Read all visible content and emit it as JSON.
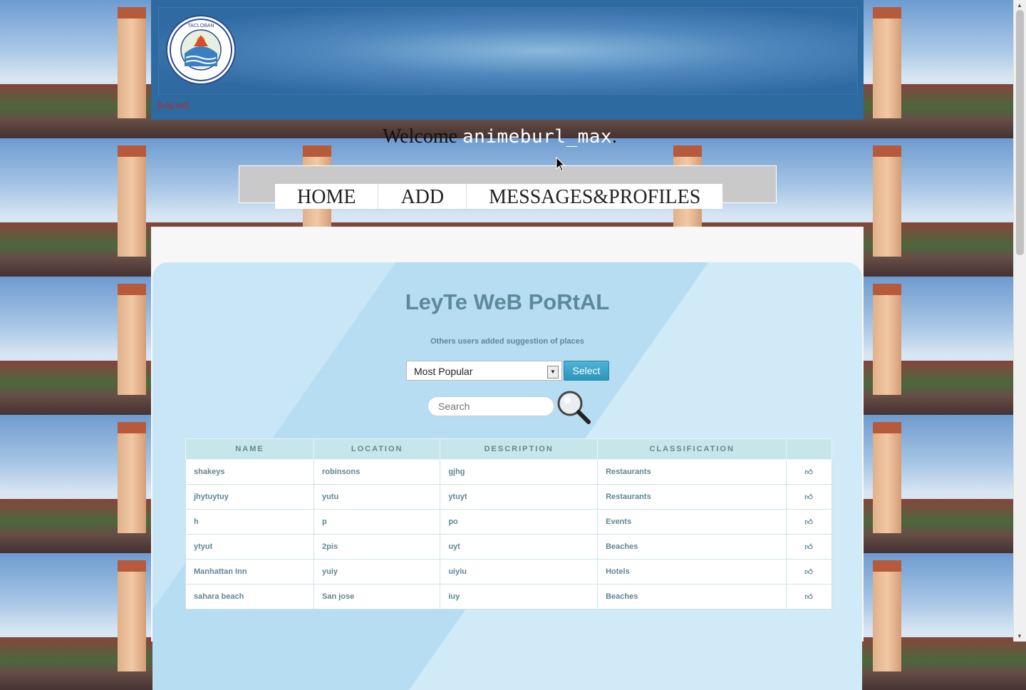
{
  "header": {
    "logo_text": "CITY OF TACLOBAN · PHILIPPINES · 19 53",
    "logout_label": "[Log out]"
  },
  "welcome": {
    "prefix": "Welcome",
    "username": "animeburl_max",
    "suffix": "."
  },
  "nav": {
    "items": [
      {
        "label": "HOME"
      },
      {
        "label": "ADD"
      },
      {
        "label": "MESSAGES&PROFILES"
      }
    ]
  },
  "main": {
    "title": "LeyTe WeB PoRtAL",
    "subtitle": "Others users added suggestion of places",
    "filter": {
      "selected": "Most Popular",
      "button_label": "Select"
    },
    "search": {
      "placeholder": "Search"
    }
  },
  "table": {
    "headers": [
      "NAME",
      "LOCATION",
      "DESCRIPTION",
      "CLASSIFICATION",
      ""
    ],
    "rows": [
      {
        "name": "shakeys",
        "location": "robinsons",
        "description": "gjhg",
        "classification": "Restaurants"
      },
      {
        "name": "jhytuytuy",
        "location": "yutu",
        "description": "ytuyt",
        "classification": "Restaurants"
      },
      {
        "name": "h",
        "location": "p",
        "description": "po",
        "classification": "Events"
      },
      {
        "name": "ytyut",
        "location": "2pis",
        "description": "uyt",
        "classification": "Beaches"
      },
      {
        "name": "Manhattan Inn",
        "location": "yuiy",
        "description": "uiyiu",
        "classification": "Hotels"
      },
      {
        "name": "sahara beach",
        "location": "San jose",
        "description": "iuy",
        "classification": "Beaches"
      }
    ],
    "like_icon": "thumbs-up-icon"
  },
  "colors": {
    "header_blue": "#2c6aa0",
    "title_teal": "#5d8a99",
    "button_blue": "#2a95bd",
    "logout_red": "#d0201e"
  }
}
